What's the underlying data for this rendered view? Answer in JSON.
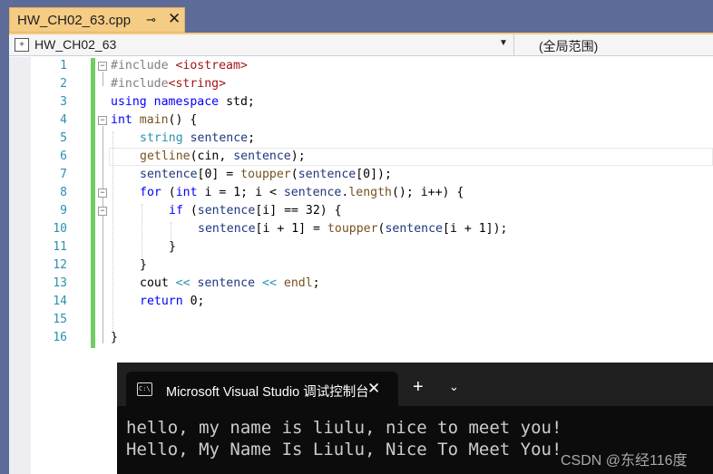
{
  "tab": {
    "title": "HW_CH02_63.cpp",
    "pin": "⊸",
    "close": "✕"
  },
  "navbar": {
    "scope_label": "HW_CH02_63",
    "dropdown_arrow": "▼",
    "right_label": "(全局范围)"
  },
  "line_numbers": [
    "1",
    "2",
    "3",
    "4",
    "5",
    "6",
    "7",
    "8",
    "9",
    "10",
    "11",
    "12",
    "13",
    "14",
    "15",
    "16"
  ],
  "code": {
    "l1": {
      "kw": "#include",
      "sp": " ",
      "hdr": "<iostream>"
    },
    "l2": {
      "kw": "#include",
      "hdr": "<string>"
    },
    "l3": {
      "using": "using",
      "namespace": "namespace",
      "std": "std",
      "semi": ";"
    },
    "l4": {
      "int": "int",
      "main": "main",
      "rest": "() {"
    },
    "l5": {
      "type": "string",
      "var": "sentence",
      "semi": ";"
    },
    "l6": {
      "fn": "getline",
      "open": "(cin, ",
      "var": "sentence",
      "close": ");"
    },
    "l7": {
      "var1": "sentence",
      "mid1": "[0] = ",
      "fn": "toupper",
      "open": "(",
      "var2": "sentence",
      "close": "[0]);"
    },
    "l8": {
      "for": "for",
      "open": " (",
      "int": "int",
      "rest1": " i = 1; i < ",
      "var": "sentence",
      "dot": ".",
      "fn": "length",
      "rest2": "(); i++) {"
    },
    "l9": {
      "if": "if",
      "open": " (",
      "var": "sentence",
      "rest": "[i] == 32) {"
    },
    "l10": {
      "var1": "sentence",
      "mid": "[i + 1] = ",
      "fn": "toupper",
      "open": "(",
      "var2": "sentence",
      "close": "[i + 1]);"
    },
    "l11": "}",
    "l12": "}",
    "l13": {
      "cout": "cout ",
      "op1": "<<",
      "sp1": " ",
      "var": "sentence",
      "sp2": " ",
      "op2": "<<",
      "sp3": " ",
      "endl": "endl",
      "semi": ";"
    },
    "l14": {
      "ret": "return",
      "rest": " 0;"
    },
    "l16": "}"
  },
  "fold_glyph": "−",
  "console": {
    "title": "Microsoft Visual Studio 调试控制台",
    "close": "✕",
    "new_tab": "+",
    "menu": "⌄",
    "icon": "C:\\",
    "output": [
      "hello, my name is liulu, nice to meet you!",
      "Hello, My Name Is Liulu, Nice To Meet You!"
    ]
  },
  "watermark": "CSDN @东经116度",
  "colors": {
    "tab_active": "#f5cc84",
    "chrome": "#5d6b99",
    "change_bar": "#6fce63",
    "keyword": "#0000ff",
    "line_number": "#2b91af"
  }
}
